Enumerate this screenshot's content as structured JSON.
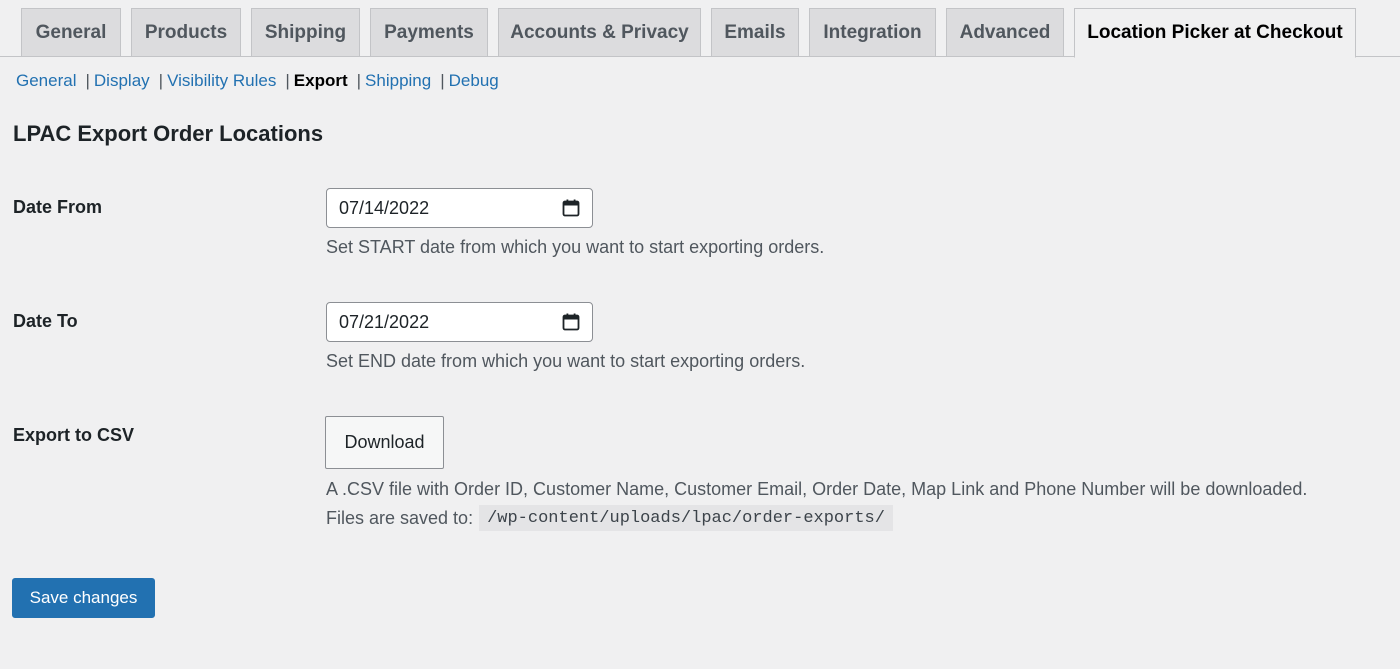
{
  "tabs": [
    {
      "label": "General"
    },
    {
      "label": "Products"
    },
    {
      "label": "Shipping"
    },
    {
      "label": "Payments"
    },
    {
      "label": "Accounts & Privacy"
    },
    {
      "label": "Emails"
    },
    {
      "label": "Integration"
    },
    {
      "label": "Advanced"
    },
    {
      "label": "Location Picker at Checkout",
      "active": true
    }
  ],
  "subnav": {
    "separator": "|",
    "items": [
      {
        "label": "General"
      },
      {
        "label": "Display"
      },
      {
        "label": "Visibility Rules"
      },
      {
        "label": "Export",
        "current": true
      },
      {
        "label": "Shipping"
      },
      {
        "label": "Debug"
      }
    ]
  },
  "section_title": "LPAC Export Order Locations",
  "date_from": {
    "label": "Date From",
    "value": "07/14/2022",
    "description": "Set START date from which you want to start exporting orders."
  },
  "date_to": {
    "label": "Date To",
    "value": "07/21/2022",
    "description": "Set END date from which you want to start exporting orders."
  },
  "export_csv": {
    "label": "Export to CSV",
    "button_label": "Download",
    "description": "A .CSV file with Order ID, Customer Name, Customer Email, Order Date, Map Link and Phone Number will be downloaded.",
    "path_prefix": "Files are saved to:",
    "path": "/wp-content/uploads/lpac/order-exports/"
  },
  "save_label": "Save changes",
  "icons": {
    "date_picker": "calendar-icon"
  },
  "colors": {
    "link": "#2271b1",
    "primary_button": "#2271b1",
    "background": "#f0f0f1",
    "inactive_tab": "#dcdcde"
  }
}
